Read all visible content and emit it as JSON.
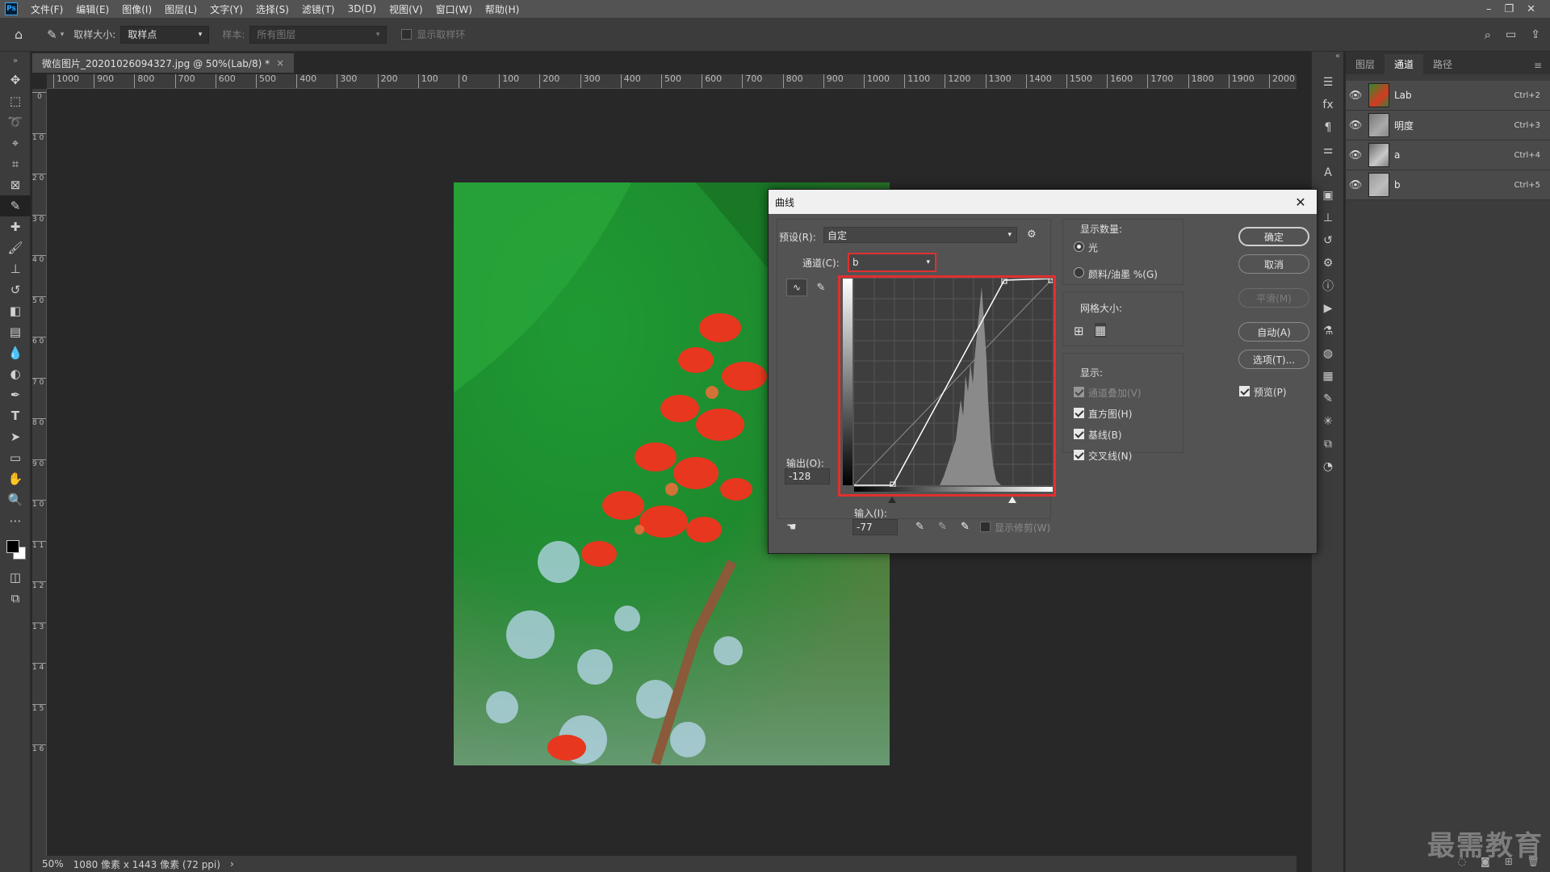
{
  "menubar": {
    "logo": "Ps",
    "items": [
      "文件(F)",
      "编辑(E)",
      "图像(I)",
      "图层(L)",
      "文字(Y)",
      "选择(S)",
      "滤镜(T)",
      "3D(D)",
      "视图(V)",
      "窗口(W)",
      "帮助(H)"
    ],
    "window_buttons": [
      "–",
      "❐",
      "✕"
    ]
  },
  "options": {
    "sample_size_label": "取样大小:",
    "sample_size_value": "取样点",
    "sample_label": "样本:",
    "sample_value": "所有图层",
    "show_ring_label": "显示取样环"
  },
  "document": {
    "tab_title": "微信图片_20201026094327.jpg @ 50%(Lab/8) *",
    "tab_close": "×"
  },
  "rulers": {
    "h_ticks": [
      "1000",
      "900",
      "800",
      "700",
      "600",
      "500",
      "400",
      "300",
      "200",
      "100",
      "0",
      "100",
      "200",
      "300",
      "400",
      "500",
      "600",
      "700",
      "800",
      "900",
      "1000",
      "1100",
      "1200",
      "1300",
      "1400",
      "1500",
      "1600",
      "1700",
      "1800",
      "1900",
      "2000"
    ],
    "v_ticks": [
      "0",
      "1 0 0",
      "2 0 0",
      "3 0 0",
      "4 0 0",
      "5 0 0",
      "6 0 0",
      "7 0 0",
      "8 0 0",
      "9 0 0",
      "1 0 0 0",
      "1 1 0 0",
      "1 2 0 0",
      "1 3 0 0",
      "1 4 0 0",
      "1 5 0 0",
      "1 6 0 0"
    ]
  },
  "status": {
    "zoom": "50%",
    "info": "1080 像素 x 1443 像素 (72 ppi)",
    "arrow": "›"
  },
  "panel": {
    "tabs": [
      "图层",
      "通道",
      "路径"
    ],
    "active_tab": 1,
    "channels": [
      {
        "name": "Lab",
        "shortcut": "Ctrl+2"
      },
      {
        "name": "明度",
        "shortcut": "Ctrl+3"
      },
      {
        "name": "a",
        "shortcut": "Ctrl+4"
      },
      {
        "name": "b",
        "shortcut": "Ctrl+5"
      }
    ]
  },
  "watermark": "最需教育",
  "dialog": {
    "title": "曲线",
    "close": "✕",
    "preset_label": "预设(R):",
    "preset_value": "自定",
    "channel_label": "通道(C):",
    "channel_value": "b",
    "output_label": "输出(O):",
    "output_value": "-128",
    "input_label": "输入(I):",
    "input_value": "-77",
    "show_clipping_label": "显示修剪(W)",
    "display_amount_label": "显示数量:",
    "light_label": "光",
    "pigment_label": "颜料/油墨 %(G)",
    "grid_size_label": "网格大小:",
    "show_label": "显示:",
    "channel_overlay_label": "通道叠加(V)",
    "histogram_label": "直方图(H)",
    "baseline_label": "基线(B)",
    "intersection_label": "交叉线(N)",
    "ok_label": "确定",
    "cancel_label": "取消",
    "smooth_label": "平滑(M)",
    "auto_label": "自动(A)",
    "options_label": "选项(T)...",
    "preview_label": "预览(P)"
  },
  "colors": {
    "highlight_red": "#e0302f",
    "panel_bg": "#3c3c3c",
    "dialog_bg": "#535353"
  }
}
